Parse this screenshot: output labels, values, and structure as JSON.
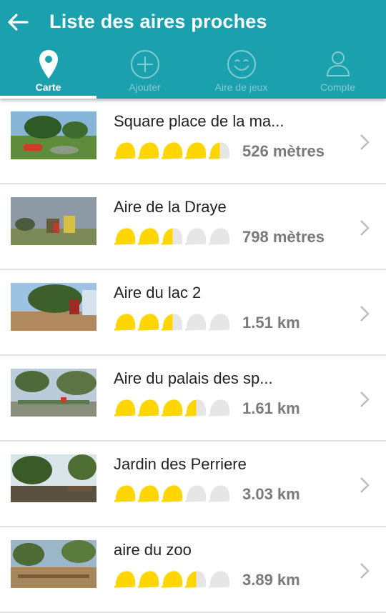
{
  "header": {
    "title": "Liste des aires proches",
    "back_icon": "arrow-left-icon"
  },
  "tabs": [
    {
      "label": "Carte",
      "icon": "map-pin-icon",
      "active": true
    },
    {
      "label": "Ajouter",
      "icon": "plus-circle-icon",
      "active": false
    },
    {
      "label": "Aire de jeux",
      "icon": "smiley-icon",
      "active": false
    },
    {
      "label": "Compte",
      "icon": "user-icon",
      "active": false
    }
  ],
  "colors": {
    "primary": "#1ba0ad",
    "rating_filled": "#ffd600",
    "rating_empty": "#e6e6e6",
    "distance": "#7a7a7a"
  },
  "places": [
    {
      "name": "Square place de la ma...",
      "distance": "526 mètres",
      "rating": 4.5
    },
    {
      "name": "Aire de la Draye",
      "distance": "798 mètres",
      "rating": 2.5
    },
    {
      "name": "Aire du lac 2",
      "distance": "1.51 km",
      "rating": 2.5
    },
    {
      "name": "Aire du palais des sp...",
      "distance": "1.61 km",
      "rating": 3.5
    },
    {
      "name": "Jardin des Perriere",
      "distance": "3.03 km",
      "rating": 3
    },
    {
      "name": "aire du zoo",
      "distance": "3.89 km",
      "rating": 3.5
    }
  ]
}
